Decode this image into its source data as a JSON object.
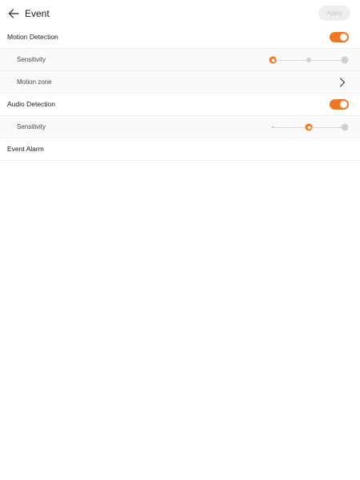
{
  "header": {
    "title": "Event",
    "apply_label": "Apply"
  },
  "rows": {
    "motion_detection": {
      "label": "Motion Detection",
      "enabled": true
    },
    "motion_sensitivity": {
      "label": "Sensitivity",
      "level_index": 0,
      "levels": 3
    },
    "motion_zone": {
      "label": "Motion zone"
    },
    "audio_detection": {
      "label": "Audio Detection",
      "enabled": true
    },
    "audio_sensitivity": {
      "label": "Sensitivity",
      "level_index": 1,
      "levels": 3
    },
    "event_alarm": {
      "label": "Event Alarm"
    }
  },
  "colors": {
    "accent": "#ee7726",
    "apply_disabled_bg": "#eeeeee",
    "apply_disabled_text": "#c9c9c9"
  },
  "icons": {
    "back": "arrow-left-icon",
    "chevron": "chevron-right-icon"
  }
}
